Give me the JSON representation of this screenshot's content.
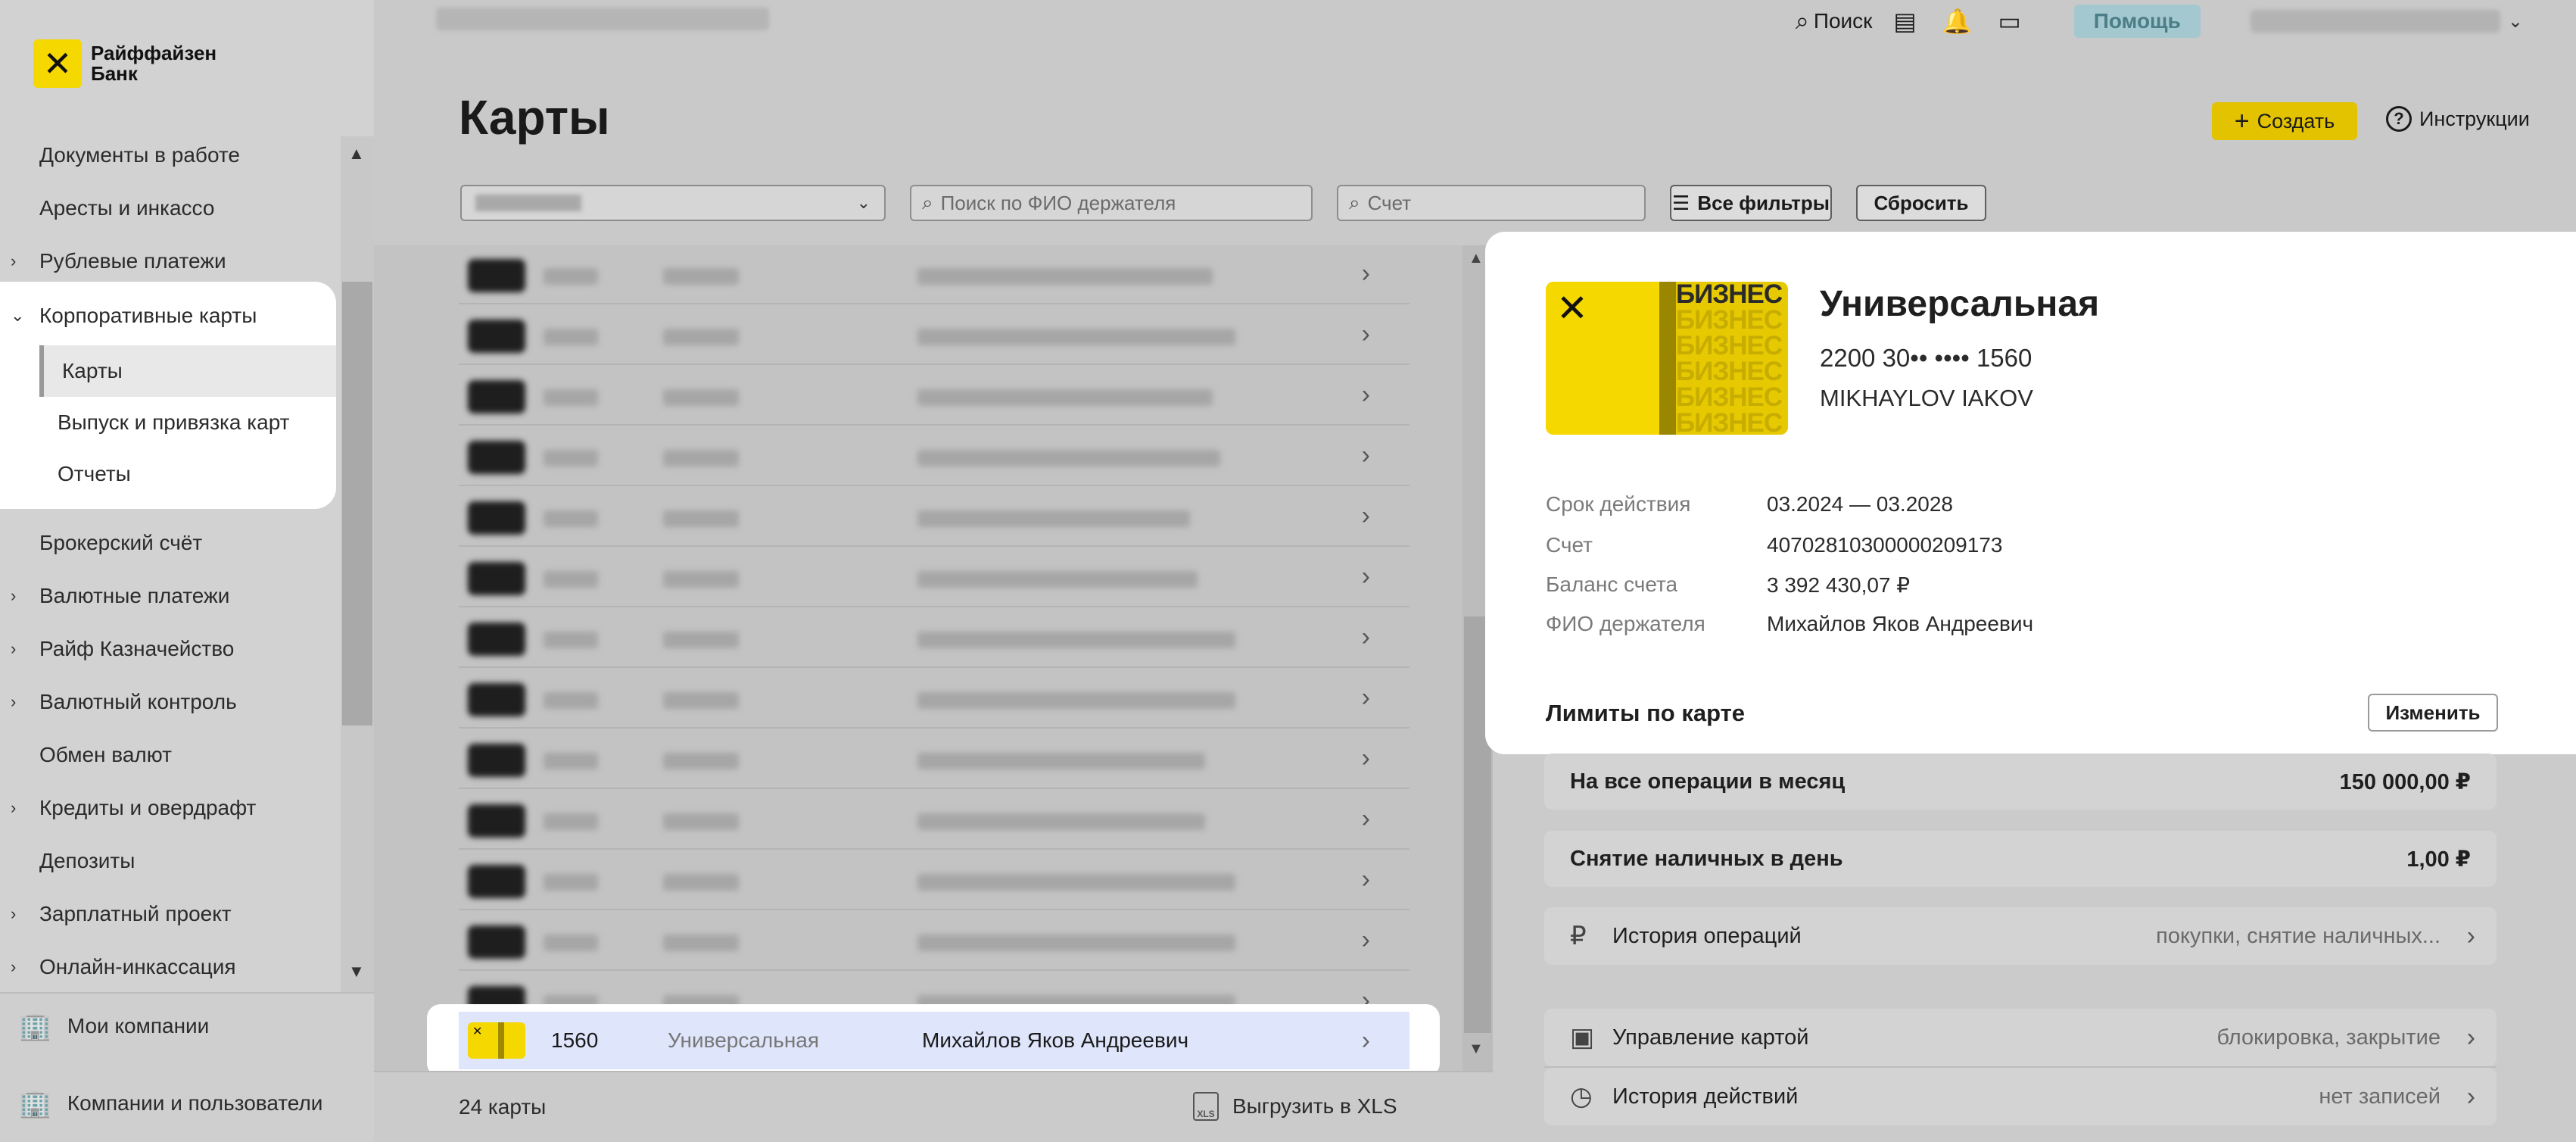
{
  "logo": {
    "mark": "✕",
    "line1": "Райффайзен",
    "line2": "Банк"
  },
  "sidebar": {
    "items_top": [
      {
        "label": "Документы в работе",
        "chevron": false
      },
      {
        "label": "Аресты и инкассо",
        "chevron": false
      },
      {
        "label": "Рублевые платежи",
        "chevron": true
      }
    ],
    "group": {
      "label": "Корпоративные карты",
      "sub": [
        {
          "label": "Карты"
        },
        {
          "label": "Выпуск и привязка карт"
        },
        {
          "label": "Отчеты"
        }
      ]
    },
    "items_bottom": [
      {
        "label": "Брокерский счёт",
        "chevron": false
      },
      {
        "label": "Валютные платежи",
        "chevron": true
      },
      {
        "label": "Райф Казначейство",
        "chevron": true
      },
      {
        "label": "Валютный контроль",
        "chevron": true
      },
      {
        "label": "Обмен валют",
        "chevron": false
      },
      {
        "label": "Кредиты и овердрафт",
        "chevron": true
      },
      {
        "label": "Депозиты",
        "chevron": false
      },
      {
        "label": "Зарплатный проект",
        "chevron": true
      },
      {
        "label": "Онлайн-инкассация",
        "chevron": true
      }
    ],
    "bottom_links": [
      {
        "label": "Мои компании",
        "icon": "building-icon"
      },
      {
        "label": "Компании и пользователи",
        "icon": "buildings-icon"
      }
    ]
  },
  "topbar": {
    "search": "Поиск",
    "help": "Помощь"
  },
  "page": {
    "title": "Карты",
    "create": "Создать",
    "instructions": "Инструкции",
    "search_fio_placeholder": "Поиск по ФИО держателя",
    "account_placeholder": "Счет",
    "all_filters": "Все фильтры",
    "reset": "Сбросить"
  },
  "selected_row": {
    "number": "1560",
    "type": "Универсальная",
    "holder": "Михайлов Яков Андреевич"
  },
  "footer": {
    "count": "24 карты",
    "export": "Выгрузить в XLS",
    "xls_icon": "XLS"
  },
  "detail": {
    "badge": "БИЗНЕС",
    "title": "Универсальная",
    "number": "2200 30•• •••• 1560",
    "name": "MIKHAYLOV IAKOV",
    "info": [
      {
        "label": "Срок действия",
        "value": "03.2024 — 03.2028"
      },
      {
        "label": "Счет",
        "value": "40702810300000209173"
      },
      {
        "label": "Баланс счета",
        "value": "3 392 430,07 ₽"
      },
      {
        "label": "ФИО держателя",
        "value": "Михайлов Яков Андреевич"
      }
    ],
    "limits_title": "Лимиты по карте",
    "change": "Изменить",
    "limits": [
      {
        "label": "На все операции в месяц",
        "value": "150 000,00 ₽"
      },
      {
        "label": "Снятие наличных в день",
        "value": "1,00 ₽"
      }
    ],
    "history": {
      "label": "История операций",
      "hint": "покупки, снятие наличных..."
    },
    "manage": {
      "label": "Управление картой",
      "hint": "блокировка, закрытие"
    },
    "actions_history": {
      "label": "История действий",
      "hint": "нет записей"
    }
  },
  "colors": {
    "brand_yellow": "#f5d800",
    "selected_row": "#dfe5fb",
    "help_button": "#a4c8cf"
  }
}
